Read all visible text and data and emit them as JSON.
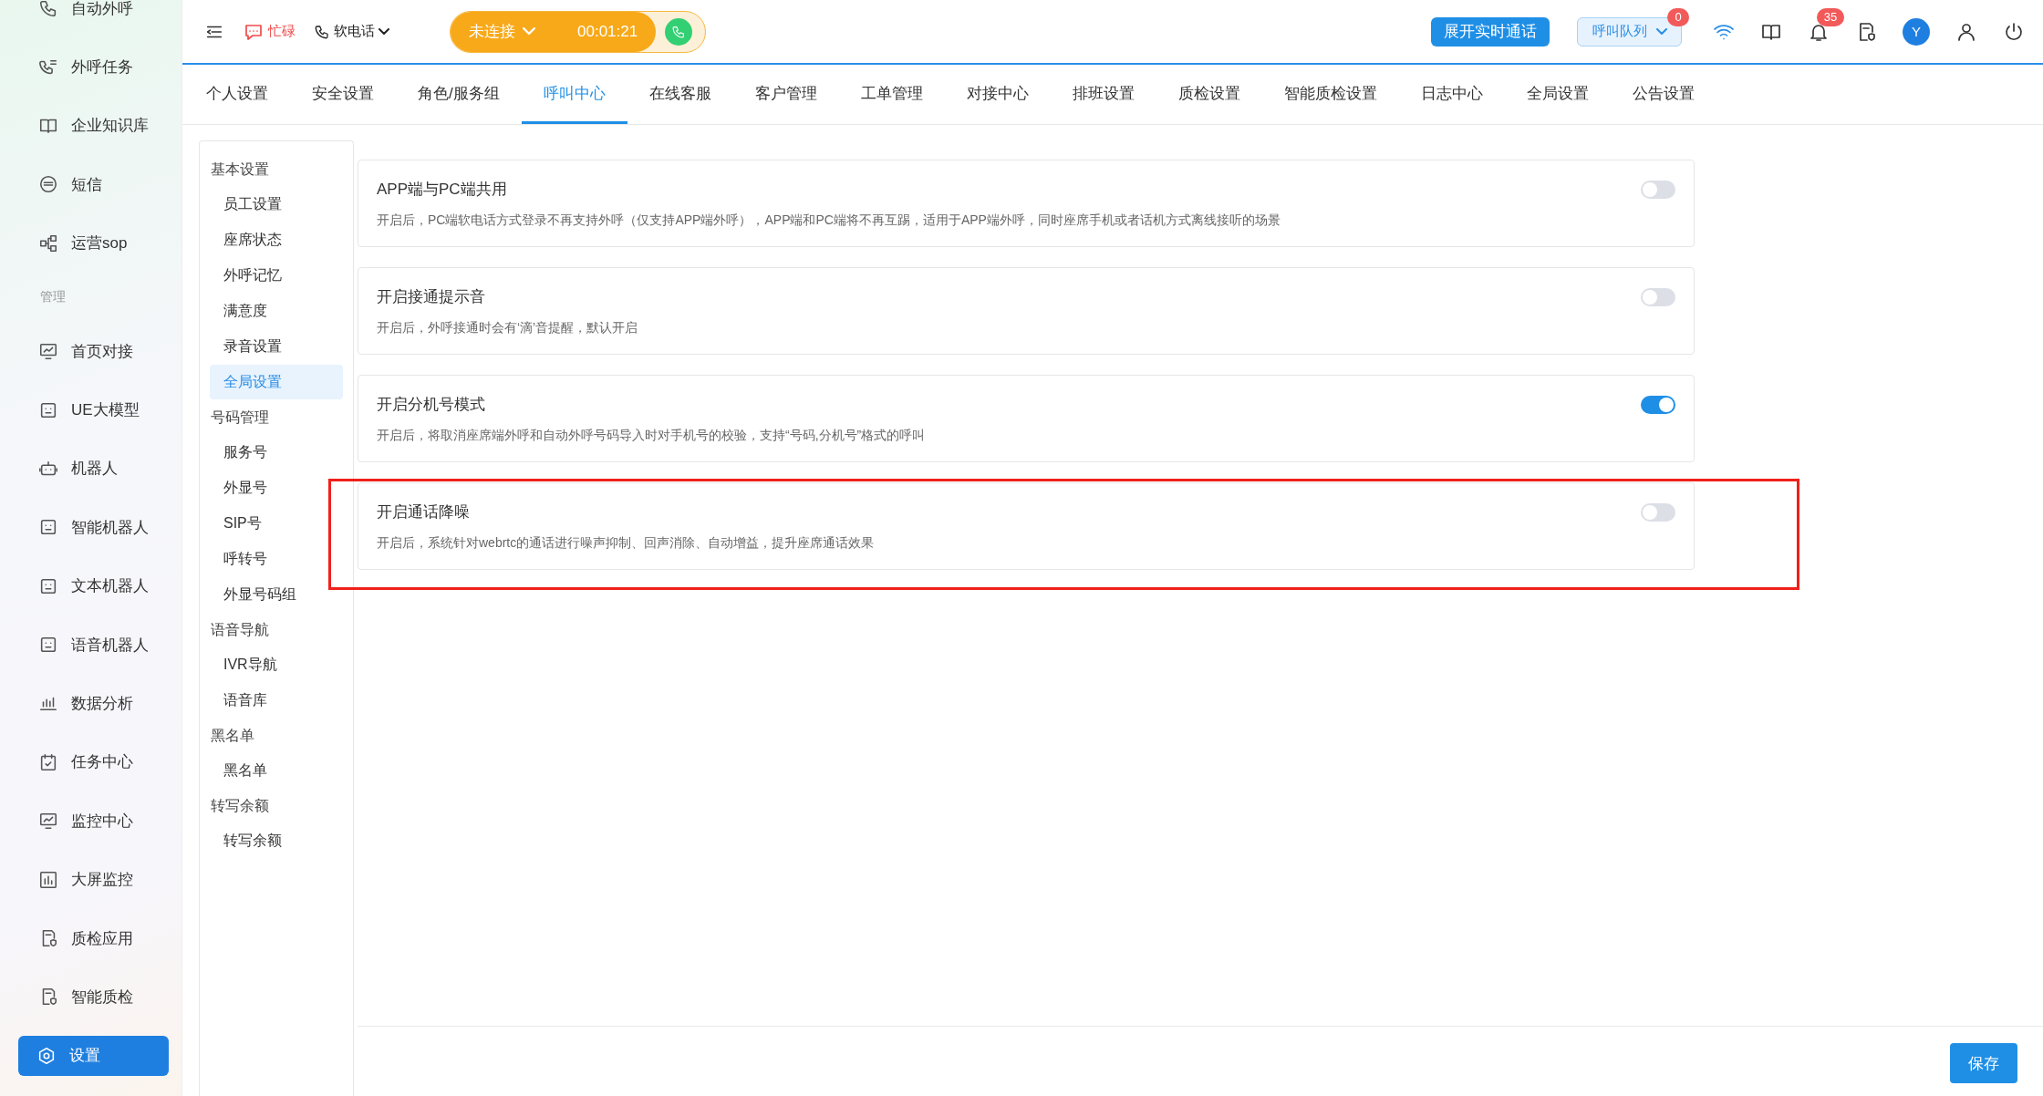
{
  "sidebar": {
    "items": [
      {
        "kind": "item",
        "label": "自动外呼",
        "selected": false
      },
      {
        "kind": "item",
        "label": "外呼任务",
        "selected": false
      },
      {
        "kind": "item",
        "label": "企业知识库",
        "selected": false
      },
      {
        "kind": "item",
        "label": "短信",
        "selected": false
      },
      {
        "kind": "item",
        "label": "运营sop",
        "selected": false
      },
      {
        "kind": "section",
        "label": "管理"
      },
      {
        "kind": "item",
        "label": "首页对接",
        "selected": false
      },
      {
        "kind": "item",
        "label": "UE大模型",
        "selected": false
      },
      {
        "kind": "item",
        "label": "机器人",
        "selected": false
      },
      {
        "kind": "item",
        "label": "智能机器人",
        "selected": false
      },
      {
        "kind": "item",
        "label": "文本机器人",
        "selected": false
      },
      {
        "kind": "item",
        "label": "语音机器人",
        "selected": false
      },
      {
        "kind": "item",
        "label": "数据分析",
        "selected": false
      },
      {
        "kind": "item",
        "label": "任务中心",
        "selected": false
      },
      {
        "kind": "item",
        "label": "监控中心",
        "selected": false
      },
      {
        "kind": "item",
        "label": "大屏监控",
        "selected": false
      },
      {
        "kind": "item",
        "label": "质检应用",
        "selected": false
      },
      {
        "kind": "item",
        "label": "智能质检",
        "selected": false
      },
      {
        "kind": "item",
        "label": "设置",
        "selected": true
      }
    ]
  },
  "topbar": {
    "status": "忙碌",
    "phone_mode": "软电话",
    "connection": "未连接",
    "timer": "00:01:21",
    "live_call_button": "展开实时通话",
    "queue": {
      "label": "呼叫队列",
      "badge": "0"
    },
    "notification_badge": "35",
    "avatar": "Y"
  },
  "tabs": [
    {
      "label": "个人设置",
      "selected": false
    },
    {
      "label": "安全设置",
      "selected": false
    },
    {
      "label": "角色/服务组",
      "selected": false
    },
    {
      "label": "呼叫中心",
      "selected": true
    },
    {
      "label": "在线客服",
      "selected": false
    },
    {
      "label": "客户管理",
      "selected": false
    },
    {
      "label": "工单管理",
      "selected": false
    },
    {
      "label": "对接中心",
      "selected": false
    },
    {
      "label": "排班设置",
      "selected": false
    },
    {
      "label": "质检设置",
      "selected": false
    },
    {
      "label": "智能质检设置",
      "selected": false
    },
    {
      "label": "日志中心",
      "selected": false
    },
    {
      "label": "全局设置",
      "selected": false
    },
    {
      "label": "公告设置",
      "selected": false
    }
  ],
  "subnav": [
    {
      "title": "基本设置",
      "items": [
        {
          "label": "员工设置",
          "selected": false
        },
        {
          "label": "座席状态",
          "selected": false
        },
        {
          "label": "外呼记忆",
          "selected": false
        },
        {
          "label": "满意度",
          "selected": false
        },
        {
          "label": "录音设置",
          "selected": false
        },
        {
          "label": "全局设置",
          "selected": true
        }
      ]
    },
    {
      "title": "号码管理",
      "items": [
        {
          "label": "服务号",
          "selected": false
        },
        {
          "label": "外显号",
          "selected": false
        },
        {
          "label": "SIP号",
          "selected": false
        },
        {
          "label": "呼转号",
          "selected": false
        },
        {
          "label": "外显号码组",
          "selected": false
        }
      ]
    },
    {
      "title": "语音导航",
      "items": [
        {
          "label": "IVR导航",
          "selected": false
        },
        {
          "label": "语音库",
          "selected": false
        }
      ]
    },
    {
      "title": "黑名单",
      "items": [
        {
          "label": "黑名单",
          "selected": false
        }
      ]
    },
    {
      "title": "转写余额",
      "items": [
        {
          "label": "转写余额",
          "selected": false
        }
      ]
    }
  ],
  "settings": [
    {
      "title": "APP端与PC端共用",
      "description": "开启后，PC端软电话方式登录不再支持外呼（仅支持APP端外呼），APP端和PC端将不再互踢，适用于APP端外呼，同时座席手机或者话机方式离线接听的场景",
      "on": false
    },
    {
      "title": "开启接通提示音",
      "description": "开启后，外呼接通时会有‘滴’音提醒，默认开启",
      "on": false
    },
    {
      "title": "开启分机号模式",
      "description": "开启后，将取消座席端外呼和自动外呼号码导入时对手机号的校验，支持“号码,分机号”格式的呼叫",
      "on": true
    },
    {
      "title": "开启通话降噪",
      "description": "开启后，系统针对webrtc的通话进行噪声抑制、回声消除、自动增益，提升座席通话效果",
      "on": false,
      "highlighted": true
    }
  ],
  "save_button": "保存"
}
